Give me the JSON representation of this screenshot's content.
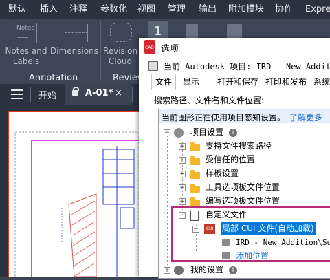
{
  "ribbon_tabs": [
    "默认",
    "插入",
    "注释",
    "参数化",
    "视图",
    "管理",
    "输出",
    "附加模块",
    "协作",
    "Expre"
  ],
  "ribbon": {
    "notes_icon_text": "Notes",
    "notes_label": "Notes and Labels",
    "dimensions_label": "Dimensions",
    "revision_cloud_label": "Revision Cloud",
    "annotation_panel": "Annotation",
    "review_panel": "Review",
    "count_badge": "1"
  },
  "doc_tabs": {
    "start": "开始",
    "current": "A-01*"
  },
  "dialog": {
    "app_icon_text": "CAD",
    "title": "选项",
    "project_line": "当前 Autodesk 项目:  IRD - New Addition",
    "tabs": [
      "文件",
      "显示",
      "打开和保存",
      "打印和发布",
      "系统"
    ],
    "section_label": "搜索路径、文件名和文件位置:",
    "info_bar": "当前图形正在使用项目感知设置。",
    "learn_more": "了解更多",
    "tree": {
      "project_settings": "项目设置",
      "support_paths": "支持文件搜索路径",
      "trusted_locations": "受信任的位置",
      "template_settings": "样板设置",
      "tool_palette_paths": "工具选项板文件位置",
      "authoring_palette_paths": "编写选项板文件位置",
      "custom_files": "自定义文件",
      "local_cui": "局部 CUI 文件(自动加载)",
      "cui_path": "IRD - New Addition\\Sup",
      "add_location": "添加位置",
      "my_settings": "我的设置"
    }
  },
  "colors": {
    "highlight_border": "#b72c7a",
    "selection": "#0078d7",
    "link": "#1e6fd0",
    "folder": "#f5b72a"
  }
}
